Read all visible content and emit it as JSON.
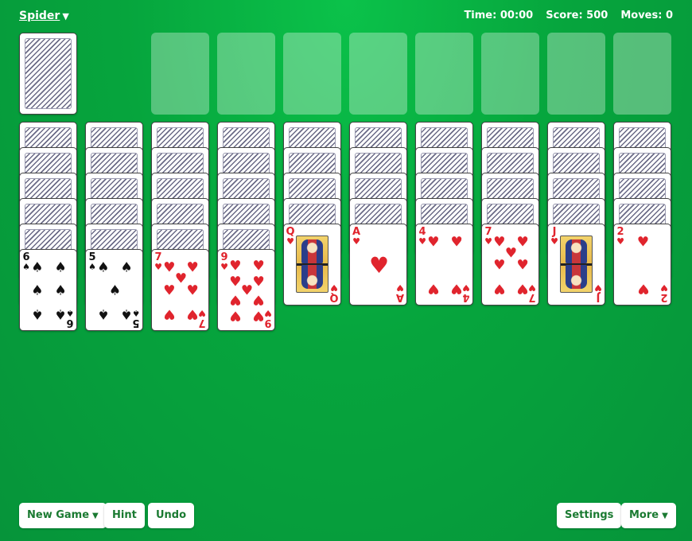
{
  "header": {
    "game_menu_label": "Spider",
    "time_label": "Time: 00:00",
    "score_label": "Score: 500",
    "moves_label": "Moves: 0"
  },
  "stock": {
    "cards_shown": 1
  },
  "foundations": {
    "count": 8
  },
  "tableau": [
    {
      "face_down": 5,
      "face_up": [
        {
          "rank": "6",
          "suit": "spades",
          "symbol": "♠"
        }
      ]
    },
    {
      "face_down": 5,
      "face_up": [
        {
          "rank": "5",
          "suit": "spades",
          "symbol": "♠"
        }
      ]
    },
    {
      "face_down": 5,
      "face_up": [
        {
          "rank": "7",
          "suit": "hearts",
          "symbol": "♥"
        }
      ]
    },
    {
      "face_down": 5,
      "face_up": [
        {
          "rank": "9",
          "suit": "hearts",
          "symbol": "♥"
        }
      ]
    },
    {
      "face_down": 4,
      "face_up": [
        {
          "rank": "Q",
          "suit": "hearts",
          "symbol": "♥"
        }
      ]
    },
    {
      "face_down": 4,
      "face_up": [
        {
          "rank": "A",
          "suit": "hearts",
          "symbol": "♥"
        }
      ]
    },
    {
      "face_down": 4,
      "face_up": [
        {
          "rank": "4",
          "suit": "hearts",
          "symbol": "♥"
        }
      ]
    },
    {
      "face_down": 4,
      "face_up": [
        {
          "rank": "7",
          "suit": "hearts",
          "symbol": "♥"
        }
      ]
    },
    {
      "face_down": 4,
      "face_up": [
        {
          "rank": "J",
          "suit": "hearts",
          "symbol": "♥"
        }
      ]
    },
    {
      "face_down": 4,
      "face_up": [
        {
          "rank": "2",
          "suit": "hearts",
          "symbol": "♥"
        }
      ]
    }
  ],
  "footer": {
    "new_game_label": "New Game",
    "hint_label": "Hint",
    "undo_label": "Undo",
    "settings_label": "Settings",
    "more_label": "More"
  },
  "colors": {
    "felt": "#06a53d",
    "red_suit": "#e0242d",
    "black_suit": "#111111",
    "button_text": "#1a7a31"
  },
  "icons": {
    "menu_caret": "chevron-down-icon"
  }
}
